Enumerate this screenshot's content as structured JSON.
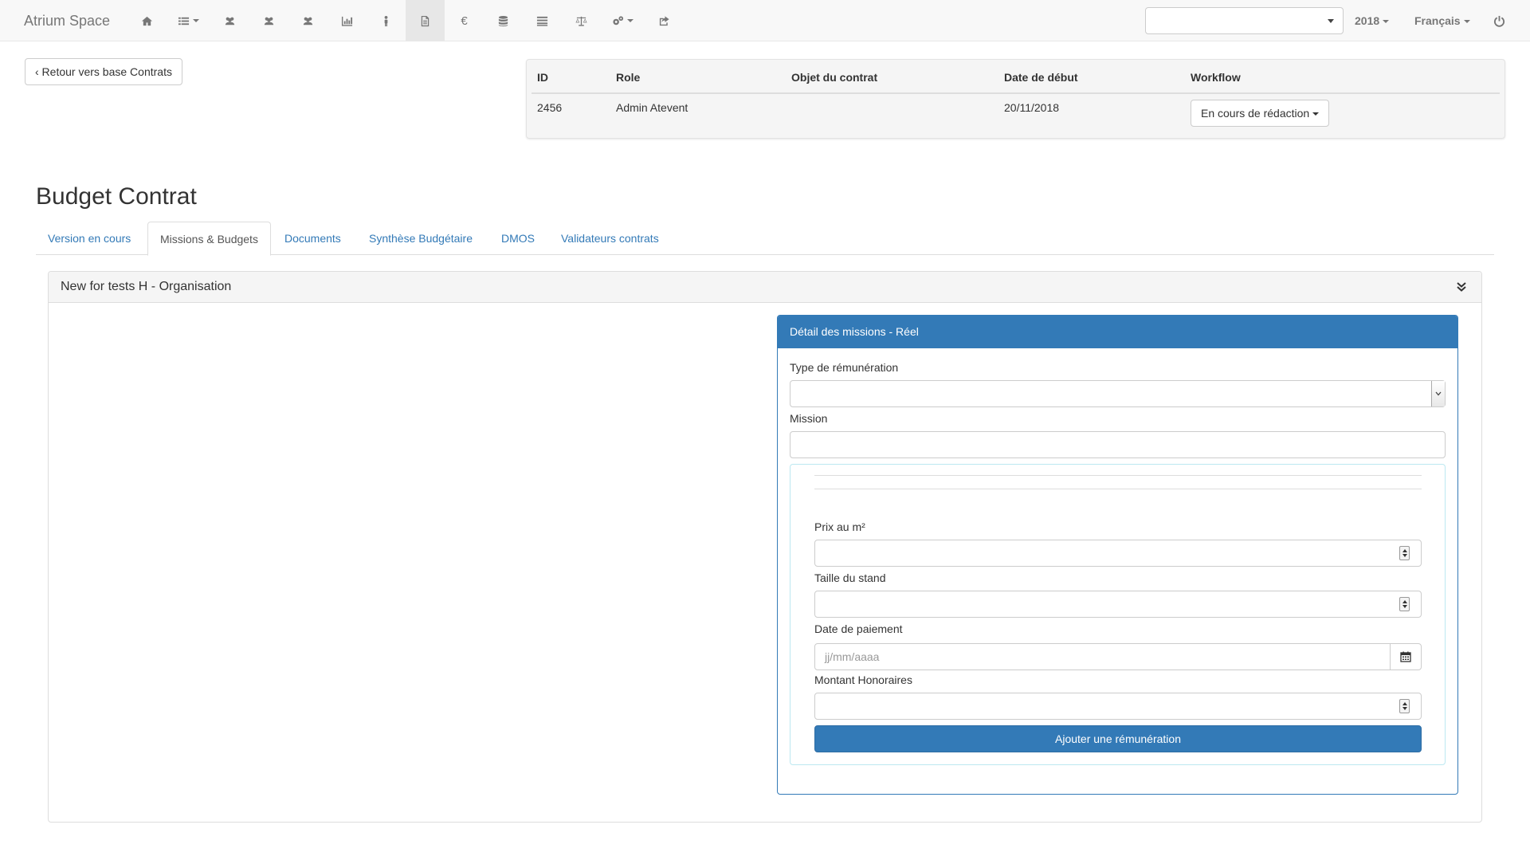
{
  "navbar": {
    "brand": "Atrium Space",
    "icons": [
      {
        "name": "home-icon",
        "dropdown": false
      },
      {
        "name": "list-menu-icon",
        "dropdown": true
      },
      {
        "name": "users-icon",
        "dropdown": false
      },
      {
        "name": "users-icon",
        "dropdown": false
      },
      {
        "name": "users-icon",
        "dropdown": false
      },
      {
        "name": "chart-icon",
        "dropdown": false
      },
      {
        "name": "person-icon",
        "dropdown": false
      },
      {
        "name": "document-icon",
        "dropdown": false,
        "active": true
      },
      {
        "name": "euro-icon",
        "dropdown": false
      },
      {
        "name": "database-icon",
        "dropdown": false
      },
      {
        "name": "list-icon",
        "dropdown": false
      },
      {
        "name": "scale-icon",
        "dropdown": false
      },
      {
        "name": "gears-icon",
        "dropdown": true
      },
      {
        "name": "share-icon",
        "dropdown": false
      }
    ],
    "euro_symbol": "€",
    "search_value": "",
    "year": "2018",
    "language": "Français"
  },
  "back_button": "‹ Retour vers base Contrats",
  "contract": {
    "headers": {
      "id": "ID",
      "role": "Role",
      "objet": "Objet du contrat",
      "date": "Date de début",
      "workflow": "Workflow"
    },
    "row": {
      "id": "2456",
      "role": "Admin Atevent",
      "objet": "",
      "date": "20/11/2018",
      "workflow": "En cours de rédaction"
    }
  },
  "page_title": "Budget Contrat",
  "tabs": [
    {
      "label": "Version en cours",
      "active": false
    },
    {
      "label": "Missions & Budgets",
      "active": true
    },
    {
      "label": "Documents",
      "active": false
    },
    {
      "label": "Synthèse Budgétaire",
      "active": false
    },
    {
      "label": "DMOS",
      "active": false
    },
    {
      "label": "Validateurs contrats",
      "active": false
    }
  ],
  "section": {
    "title": "New for tests H - Organisation"
  },
  "detail": {
    "title": "Détail des missions - Réel",
    "type_label": "Type de rémunération",
    "type_value": "",
    "mission_label": "Mission",
    "mission_value": "",
    "prix_label": "Prix au m²",
    "prix_value": "",
    "taille_label": "Taille du stand",
    "taille_value": "",
    "date_label": "Date de paiement",
    "date_placeholder": "jj/mm/aaaa",
    "montant_label": "Montant Honoraires",
    "montant_value": "",
    "add_button": "Ajouter une rémunération"
  },
  "colors": {
    "primary": "#337ab7",
    "navbar_bg": "#f8f8f8",
    "link": "#337ab7"
  }
}
